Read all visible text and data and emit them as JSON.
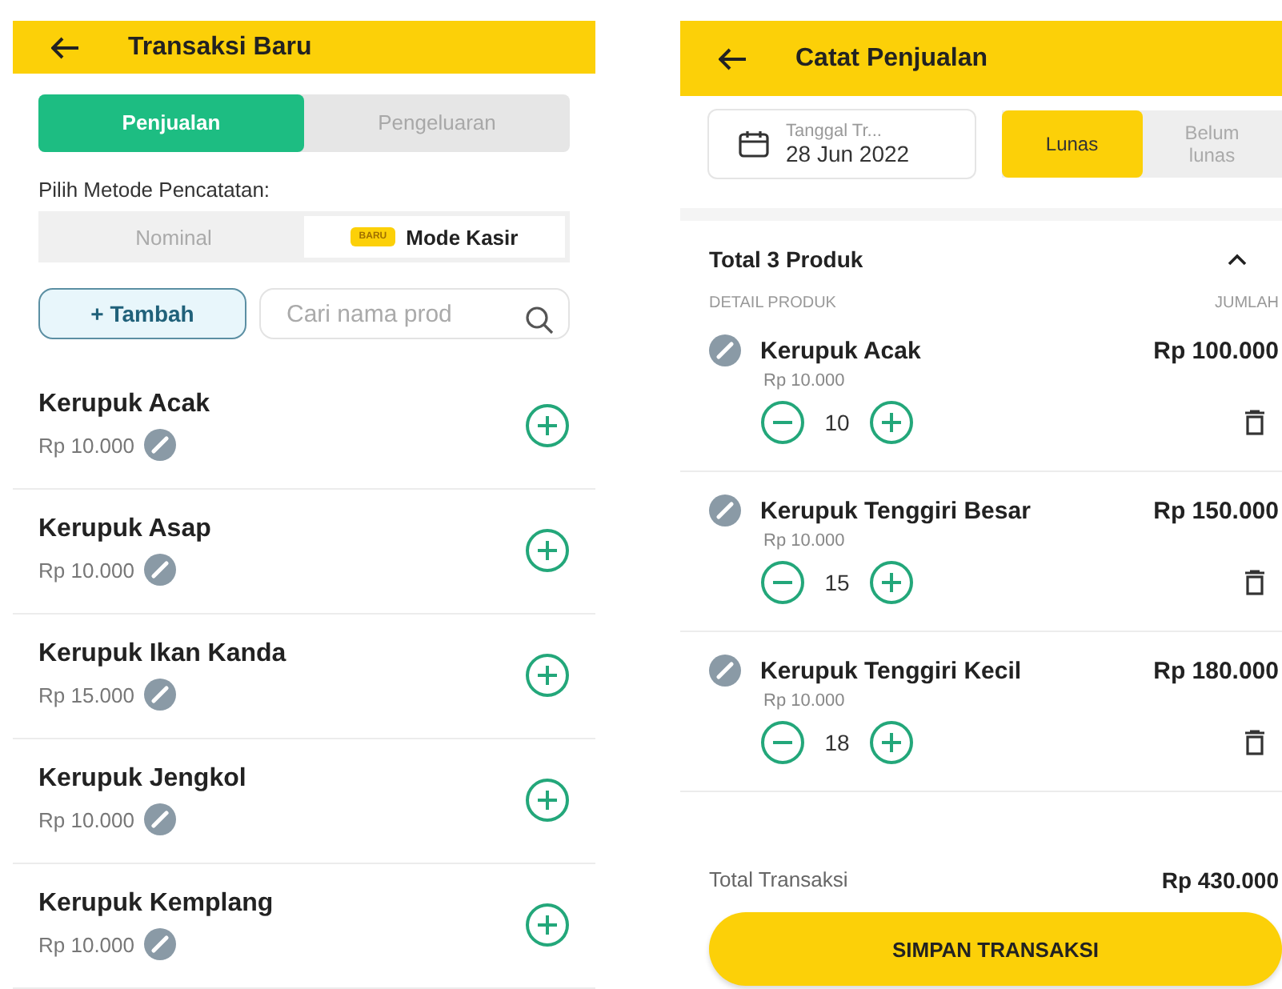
{
  "left_screen": {
    "title": "Transaksi Baru",
    "type_tabs": [
      {
        "label": "Penjualan",
        "selected": true
      },
      {
        "label": "Pengeluaran",
        "selected": false
      }
    ],
    "method_label": "Pilih Metode Pencatatan:",
    "methods": [
      {
        "label": "Nominal",
        "selected": false
      },
      {
        "label": "Mode Kasir",
        "badge": "BARU",
        "selected": true
      }
    ],
    "add_button": "+ Tambah",
    "search": {
      "placeholder": "Cari nama prod"
    },
    "products": [
      {
        "name": "Kerupuk Acak",
        "price": "Rp 10.000"
      },
      {
        "name": "Kerupuk Asap",
        "price": "Rp 10.000"
      },
      {
        "name": "Kerupuk Ikan Kanda",
        "price": "Rp 15.000"
      },
      {
        "name": "Kerupuk Jengkol",
        "price": "Rp 10.000"
      },
      {
        "name": "Kerupuk Kemplang",
        "price": "Rp 10.000"
      }
    ]
  },
  "right_screen": {
    "title": "Catat Penjualan",
    "date_field": {
      "label": "Tanggal Tr...",
      "value": "28 Jun 2022"
    },
    "payment_status": [
      {
        "label": "Lunas",
        "selected": true
      },
      {
        "label": "Belum lunas",
        "selected": false
      }
    ],
    "summary_title": "Total 3 Produk",
    "expanded": true,
    "columns": [
      "DETAIL PRODUK",
      "JUMLAH"
    ],
    "items": [
      {
        "name": "Kerupuk Acak",
        "unit_price": "Rp 10.000",
        "quantity": "10",
        "total": "Rp 100.000"
      },
      {
        "name": "Kerupuk Tenggiri Besar",
        "unit_price": "Rp 10.000",
        "quantity": "15",
        "total": "Rp 150.000"
      },
      {
        "name": "Kerupuk Tenggiri Kecil",
        "unit_price": "Rp 10.000",
        "quantity": "18",
        "total": "Rp 180.000"
      }
    ],
    "total_label": "Total Transaksi",
    "total_value": "Rp 430.000",
    "save_button": "SIMPAN TRANSAKSI"
  }
}
